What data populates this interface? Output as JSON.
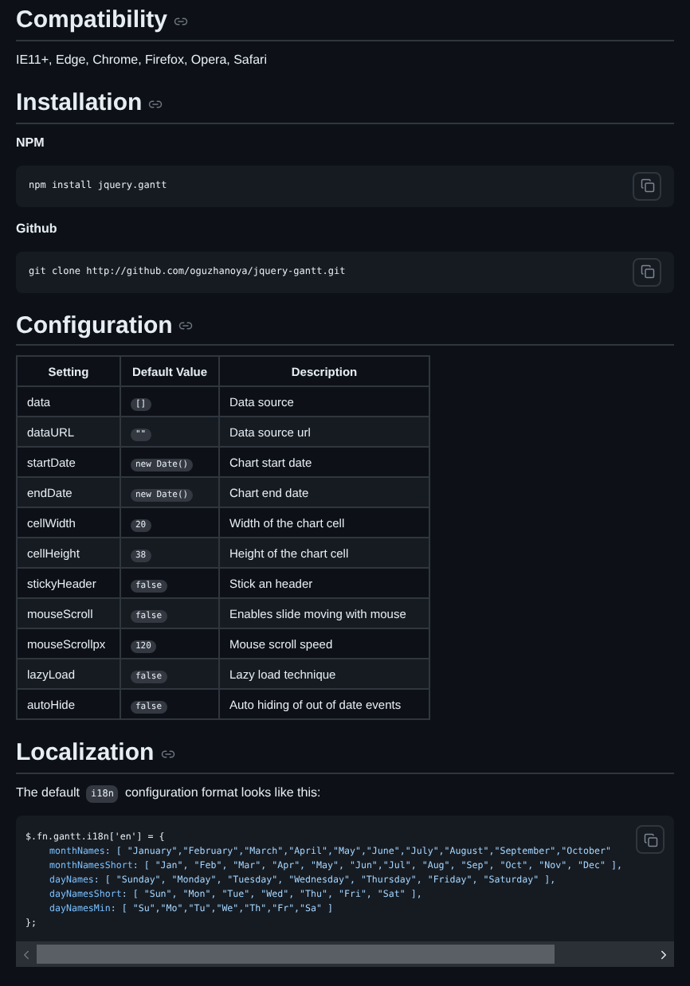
{
  "sections": [
    {
      "kind": "text",
      "heading": "Compatibility",
      "text": "IE11+, Edge, Chrome, Firefox, Opera, Safari"
    },
    {
      "kind": "install",
      "heading": "Installation",
      "blocks": [
        {
          "label": "NPM",
          "code": "npm install jquery.gantt"
        },
        {
          "label": "Github",
          "code": "git clone http://github.com/oguzhanoya/jquery-gantt.git"
        }
      ]
    },
    {
      "kind": "table",
      "heading": "Configuration",
      "columns": [
        "Setting",
        "Default Value",
        "Description"
      ],
      "rows": [
        {
          "setting": "data",
          "default": "[]",
          "description": "Data source"
        },
        {
          "setting": "dataURL",
          "default": "\"\"",
          "description": "Data source url"
        },
        {
          "setting": "startDate",
          "default": "new Date()",
          "description": "Chart start date"
        },
        {
          "setting": "endDate",
          "default": "new Date()",
          "description": "Chart end date"
        },
        {
          "setting": "cellWidth",
          "default": "20",
          "description": "Width of the chart cell"
        },
        {
          "setting": "cellHeight",
          "default": "38",
          "description": "Height of the chart cell"
        },
        {
          "setting": "stickyHeader",
          "default": "false",
          "description": "Stick an header"
        },
        {
          "setting": "mouseScroll",
          "default": "false",
          "description": "Enables slide moving with mouse"
        },
        {
          "setting": "mouseScrollpx",
          "default": "120",
          "description": "Mouse scroll speed"
        },
        {
          "setting": "lazyLoad",
          "default": "false",
          "description": "Lazy load technique"
        },
        {
          "setting": "autoHide",
          "default": "false",
          "description": "Auto hiding of out of date events"
        }
      ]
    },
    {
      "kind": "code",
      "heading": "Localization",
      "intro_before": "The default",
      "intro_code": "i18n",
      "intro_after": "configuration format looks like this:",
      "open": "$.fn.gantt.i18n['en'] = {",
      "lines": [
        {
          "key": "monthNames",
          "value": ": [ \"January\",\"February\",\"March\",\"April\",\"May\",\"June\",\"July\",\"August\",\"September\",\"October\""
        },
        {
          "key": "monthNamesShort",
          "value": ": [ \"Jan\", \"Feb\", \"Mar\", \"Apr\", \"May\", \"Jun\",\"Jul\", \"Aug\", \"Sep\", \"Oct\", \"Nov\", \"Dec\" ],"
        },
        {
          "key": "dayNames",
          "value": ": [ \"Sunday\", \"Monday\", \"Tuesday\", \"Wednesday\", \"Thursday\", \"Friday\", \"Saturday\" ],"
        },
        {
          "key": "dayNamesShort",
          "value": ": [ \"Sun\", \"Mon\", \"Tue\", \"Wed\", \"Thu\", \"Fri\", \"Sat\" ],"
        },
        {
          "key": "dayNamesMin",
          "value": ": [ \"Su\",\"Mo\",\"Tu\",\"We\",\"Th\",\"Fr\",\"Sa\" ]"
        }
      ],
      "close": "};"
    }
  ]
}
